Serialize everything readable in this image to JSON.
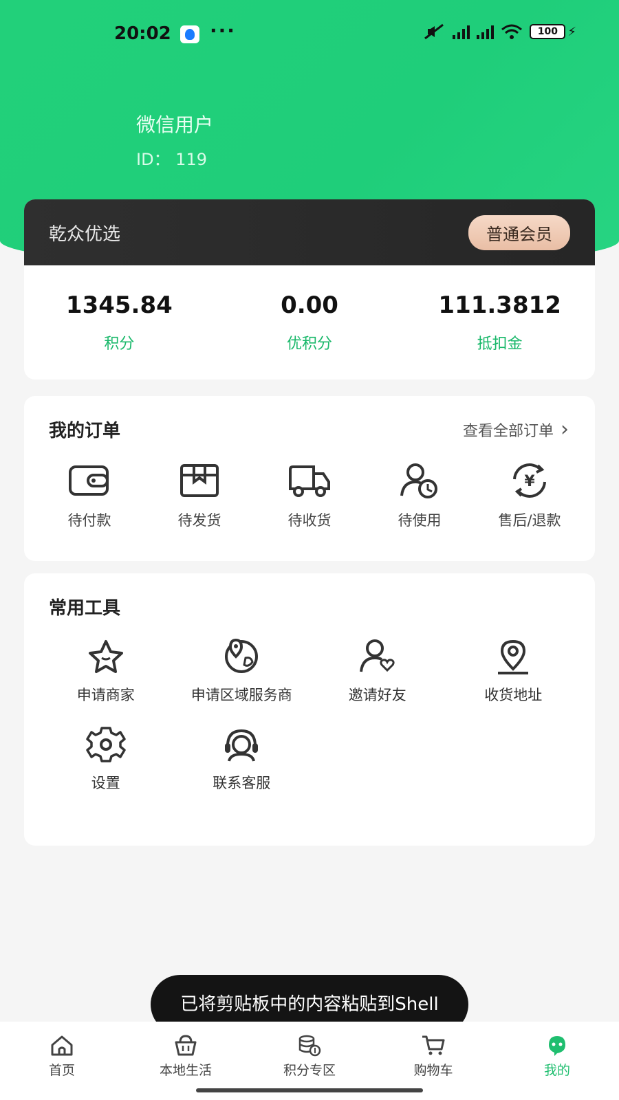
{
  "status_bar": {
    "time": "20:02",
    "dots": "···",
    "battery": "100"
  },
  "profile": {
    "name": "微信用户",
    "id": "ID：  119"
  },
  "member_card": {
    "brand": "乾众优选",
    "level": "普通会员",
    "stats": [
      {
        "value": "1345.84",
        "label": "积分"
      },
      {
        "value": "0.00",
        "label": "优积分"
      },
      {
        "value": "111.3812",
        "label": "抵扣金"
      }
    ]
  },
  "orders": {
    "title": "我的订单",
    "view_all": "查看全部订单",
    "chevron": "›",
    "items": [
      {
        "label": "待付款",
        "icon": "wallet-icon"
      },
      {
        "label": "待发货",
        "icon": "box-icon"
      },
      {
        "label": "待收货",
        "icon": "truck-icon"
      },
      {
        "label": "待使用",
        "icon": "user-clock-icon"
      },
      {
        "label": "售后/退款",
        "icon": "refund-icon"
      }
    ]
  },
  "tools": {
    "title": "常用工具",
    "items": [
      {
        "label": "申请商家",
        "icon": "star-icon"
      },
      {
        "label": "申请区域服务商",
        "icon": "globe-pin-icon"
      },
      {
        "label": "邀请好友",
        "icon": "user-heart-icon"
      },
      {
        "label": "收货地址",
        "icon": "location-icon"
      },
      {
        "label": "设置",
        "icon": "gear-icon"
      },
      {
        "label": "联系客服",
        "icon": "headset-icon"
      }
    ]
  },
  "toast": {
    "message": "已将剪贴板中的内容粘贴到Shell"
  },
  "tabbar": {
    "items": [
      {
        "label": "首页",
        "icon": "home-icon",
        "active": false
      },
      {
        "label": "本地生活",
        "icon": "basket-icon",
        "active": false
      },
      {
        "label": "积分专区",
        "icon": "coins-icon",
        "active": false
      },
      {
        "label": "购物车",
        "icon": "cart-icon",
        "active": false
      },
      {
        "label": "我的",
        "icon": "profile-icon",
        "active": true
      }
    ]
  },
  "colors": {
    "brand_green": "#1fce7a",
    "accent_green": "#19b86a",
    "card_dark": "#2f2f2f",
    "badge_peach": "#e9bea5"
  }
}
